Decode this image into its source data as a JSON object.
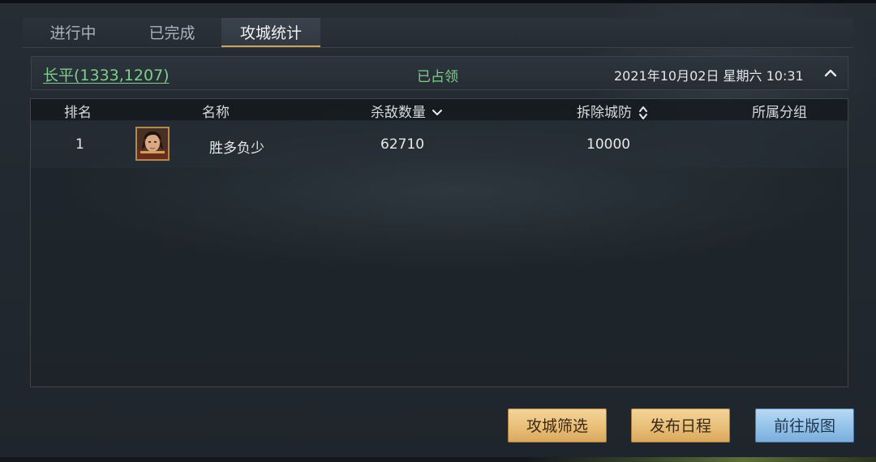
{
  "tabs": [
    {
      "label": "进行中",
      "active": false
    },
    {
      "label": "已完成",
      "active": false
    },
    {
      "label": "攻城统计",
      "active": true
    }
  ],
  "city": {
    "name": "长平(1333,1207)",
    "status": "已占领",
    "datetime": "2021年10月02日  星期六  10:31",
    "collapse_icon": "chevron-up-icon"
  },
  "table": {
    "headers": {
      "rank": "排名",
      "name": "名称",
      "kills": "杀敌数量",
      "demolish": "拆除城防",
      "group": "所属分组"
    },
    "sort_icons": {
      "kills": "chevron-down-icon",
      "demolish": "sort-updown-icon"
    },
    "rows": [
      {
        "rank": "1",
        "avatar_icon": "warrior-portrait-icon",
        "name": "胜多负少",
        "kills": "62710",
        "demolish": "10000",
        "group": ""
      }
    ]
  },
  "buttons": {
    "filter": "攻城筛选",
    "publish": "发布日程",
    "goto_map": "前往版图"
  },
  "colors": {
    "accent_green": "#7fcf8c",
    "gold_button": "#e9bf78",
    "blue_button": "#94c2e8",
    "tab_underline": "#c9a45a"
  }
}
